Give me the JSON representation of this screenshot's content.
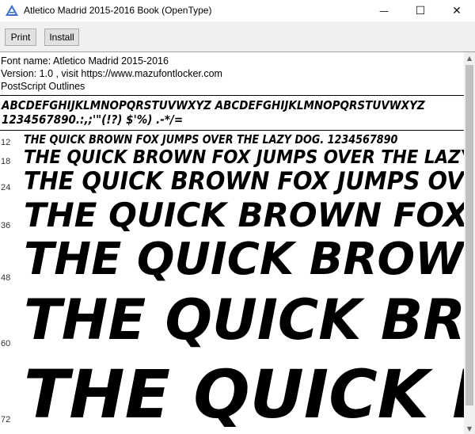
{
  "window": {
    "title": "Atletico Madrid 2015-2016 Book (OpenType)",
    "minimize": "—",
    "maximize": "☐",
    "close": "✕"
  },
  "toolbar": {
    "print_label": "Print",
    "install_label": "Install"
  },
  "font_info": {
    "name_line": "Font name: Atletico Madrid 2015-2016",
    "version_line": "Version: 1.0 , visit https://www.mazufontlocker.com",
    "outline_line": "PostScript Outlines"
  },
  "charset": {
    "line1": "ABCDEFGHIJKLMNOPQRSTUVWXYZ ABCDEFGHIJKLMNOPQRSTUVWXYZ",
    "line2": "1234567890.:,;'\"(!?) $'%) .-*/="
  },
  "samples": [
    {
      "size": "12",
      "text": "THE QUICK BROWN FOX JUMPS OVER THE LAZY DOG. 1234567890"
    },
    {
      "size": "18",
      "text": "THE QUICK BROWN FOX JUMPS OVER THE LAZY DOG"
    },
    {
      "size": "24",
      "text": "THE QUICK BROWN FOX JUMPS OVER THE"
    },
    {
      "size": "36",
      "text": "THE QUICK BROWN FOX JU"
    },
    {
      "size": "48",
      "text": "THE QUICK BROWN"
    },
    {
      "size": "60",
      "text": "THE QUICK BRO"
    },
    {
      "size": "72",
      "text": "THE QUICK B"
    }
  ]
}
